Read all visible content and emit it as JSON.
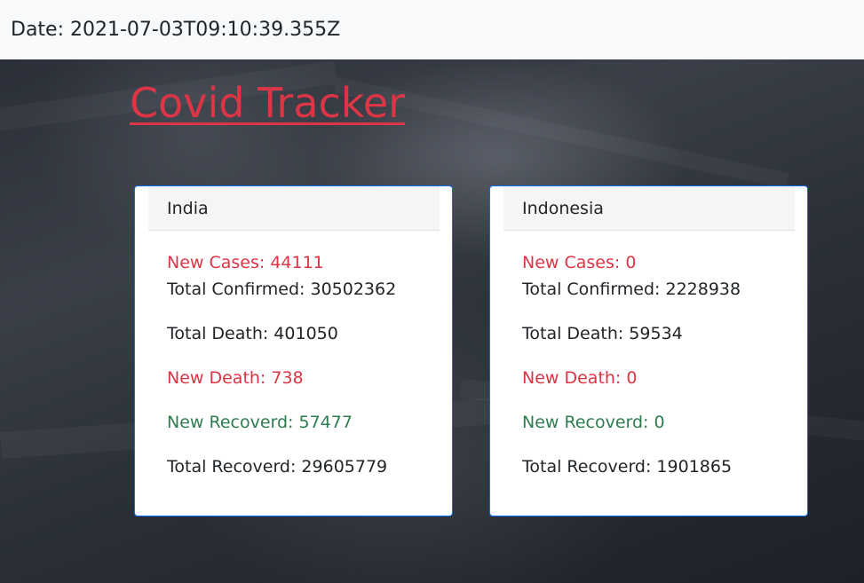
{
  "header": {
    "date_text": "Date: 2021-07-03T09:10:39.355Z"
  },
  "title": "Covid Tracker",
  "colors": {
    "title": "#dc3545",
    "new_value": "#dc3545",
    "recovered": "#2e7d4f",
    "card_border": "#0d6efd"
  },
  "countries": [
    {
      "name": "India",
      "new_cases": "New Cases: 44111",
      "total_confirmed": "Total Confirmed: 30502362",
      "total_death": "Total Death: 401050",
      "new_death": "New Death: 738",
      "new_recovered": "New Recoverd: 57477",
      "total_recovered": "Total Recoverd: 29605779"
    },
    {
      "name": "Indonesia",
      "new_cases": "New Cases: 0",
      "total_confirmed": "Total Confirmed: 2228938",
      "total_death": "Total Death: 59534",
      "new_death": "New Death: 0",
      "new_recovered": "New Recoverd: 0",
      "total_recovered": "Total Recoverd: 1901865"
    }
  ]
}
